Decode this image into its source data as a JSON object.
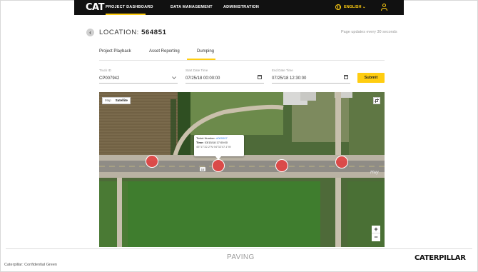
{
  "header": {
    "logo": "CAT",
    "nav": [
      "PROJECT DASHBOARD",
      "DATA MANAGEMENT",
      "ADMINISTRATION"
    ],
    "language": "ENGLISH",
    "accent_color": "#ffcd11",
    "icons": [
      "globe-icon",
      "chevron-down-icon",
      "user-icon"
    ]
  },
  "page": {
    "location_label": "LOCATION:",
    "location_id": "564851",
    "update_note": "Page updates every 30 seconds"
  },
  "tabs": [
    {
      "label": "Project Playback",
      "active": false
    },
    {
      "label": "Asset Reporting",
      "active": false
    },
    {
      "label": "Dumping",
      "active": true
    }
  ],
  "filters": {
    "truck_id": {
      "label": "Truck ID",
      "value": "CP007942"
    },
    "start_date": {
      "label": "Start Date Time",
      "value": "07/25/18 00:00:00"
    },
    "end_date": {
      "label": "End Date Time",
      "value": "07/25/18 12:30:00"
    },
    "submit_label": "Submit"
  },
  "map": {
    "toggle": [
      "Map",
      "Satellite"
    ],
    "selected_view": "Satellite",
    "highway_label": "Hwy",
    "route_shield": "10",
    "tooltip": {
      "ticket_label": "Ticket Number:",
      "ticket_number": "#000007",
      "time_label": "Time:",
      "time_value": "03/15/18 17:00:00",
      "coords": "45°17'32.2\"N 94°32'47.1\"W"
    },
    "zoom_in": "+",
    "zoom_out": "−",
    "marker_color": "#e24242"
  },
  "footer": {
    "confidential": "Caterpillar: Confidential Green",
    "section": "PAVING",
    "brand": "CATERPILLAR"
  }
}
